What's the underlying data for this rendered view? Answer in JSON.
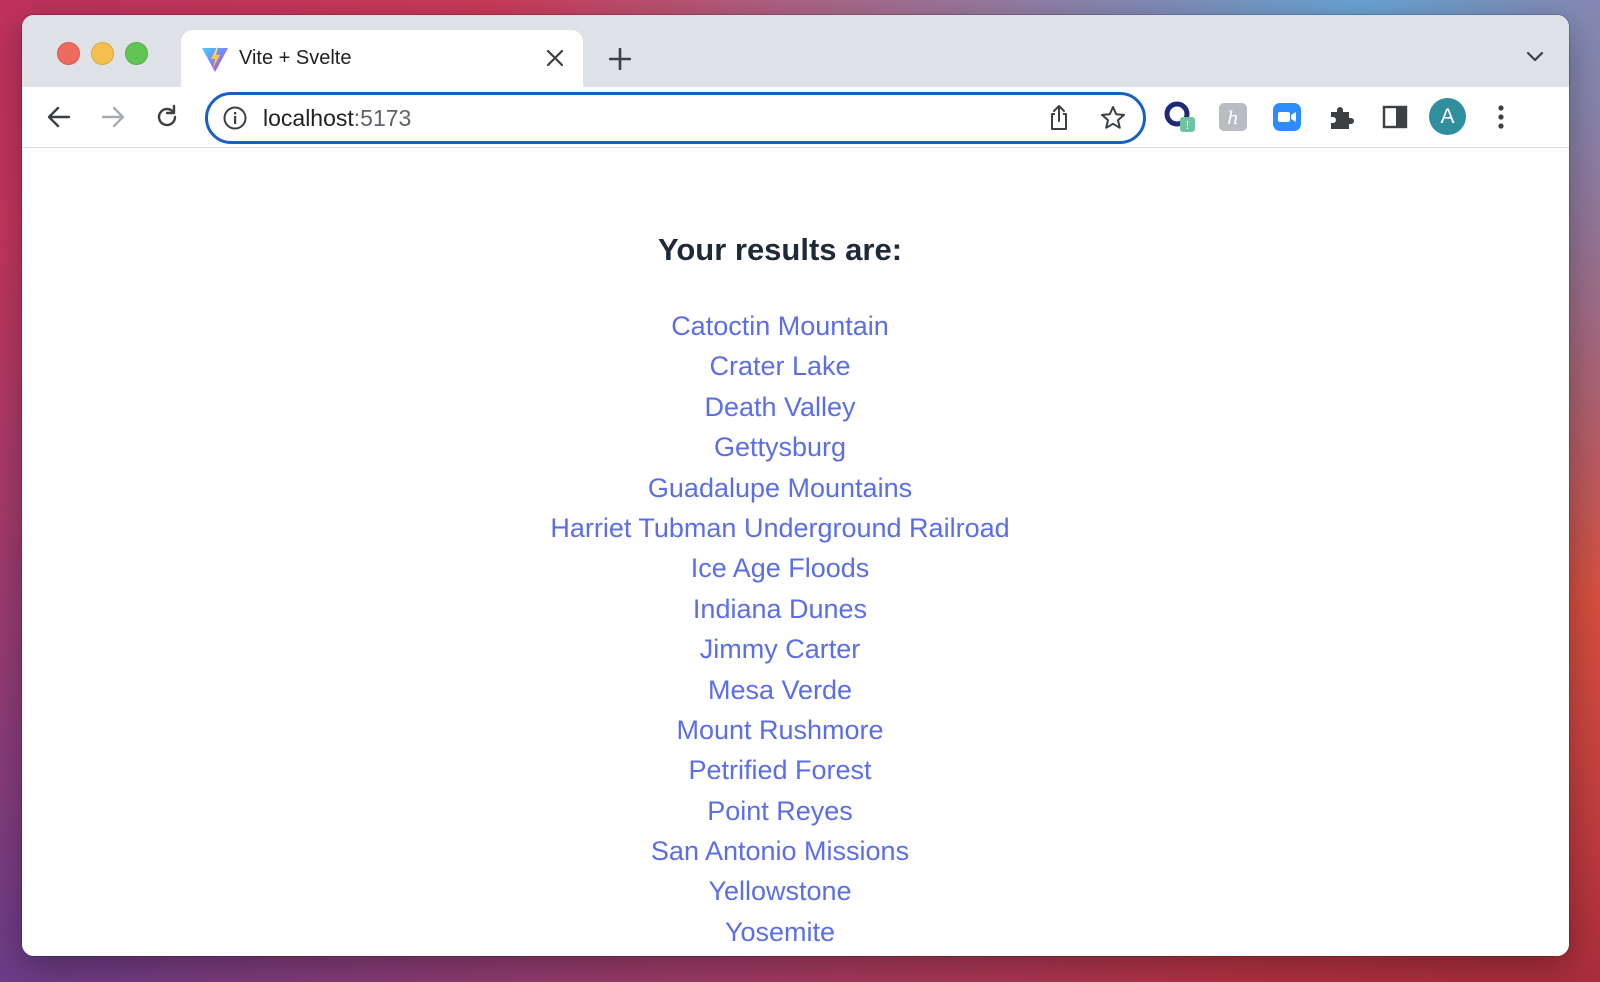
{
  "browser": {
    "tab": {
      "title": "Vite + Svelte",
      "favicon": "vite-logo-icon",
      "close_icon": "close-icon"
    },
    "new_tab_icon": "plus-icon",
    "tab_search_icon": "chevron-down-icon",
    "toolbar": {
      "back_icon": "back-arrow-icon",
      "forward_icon": "forward-arrow-icon",
      "reload_icon": "reload-icon",
      "url_host": "localhost",
      "url_port": ":5173",
      "site_info_icon": "info-icon",
      "share_icon": "share-icon",
      "bookmark_icon": "star-icon",
      "extensions": [
        "extension-badge-icon",
        "extension-honey-icon",
        "zoom-icon",
        "puzzle-icon",
        "side-panel-icon"
      ],
      "profile_initial": "A",
      "menu_icon": "more-vert-icon"
    },
    "colors": {
      "accent_focus": "#1a5fc4",
      "link": "#5b6ee8",
      "heading": "#1f2937",
      "avatar": "#2f8f9d"
    }
  },
  "page": {
    "heading": "Your results are:",
    "results": [
      "Catoctin Mountain",
      "Crater Lake",
      "Death Valley",
      "Gettysburg",
      "Guadalupe Mountains",
      "Harriet Tubman Underground Railroad",
      "Ice Age Floods",
      "Indiana Dunes",
      "Jimmy Carter",
      "Mesa Verde",
      "Mount Rushmore",
      "Petrified Forest",
      "Point Reyes",
      "San Antonio Missions",
      "Yellowstone",
      "Yosemite"
    ]
  }
}
